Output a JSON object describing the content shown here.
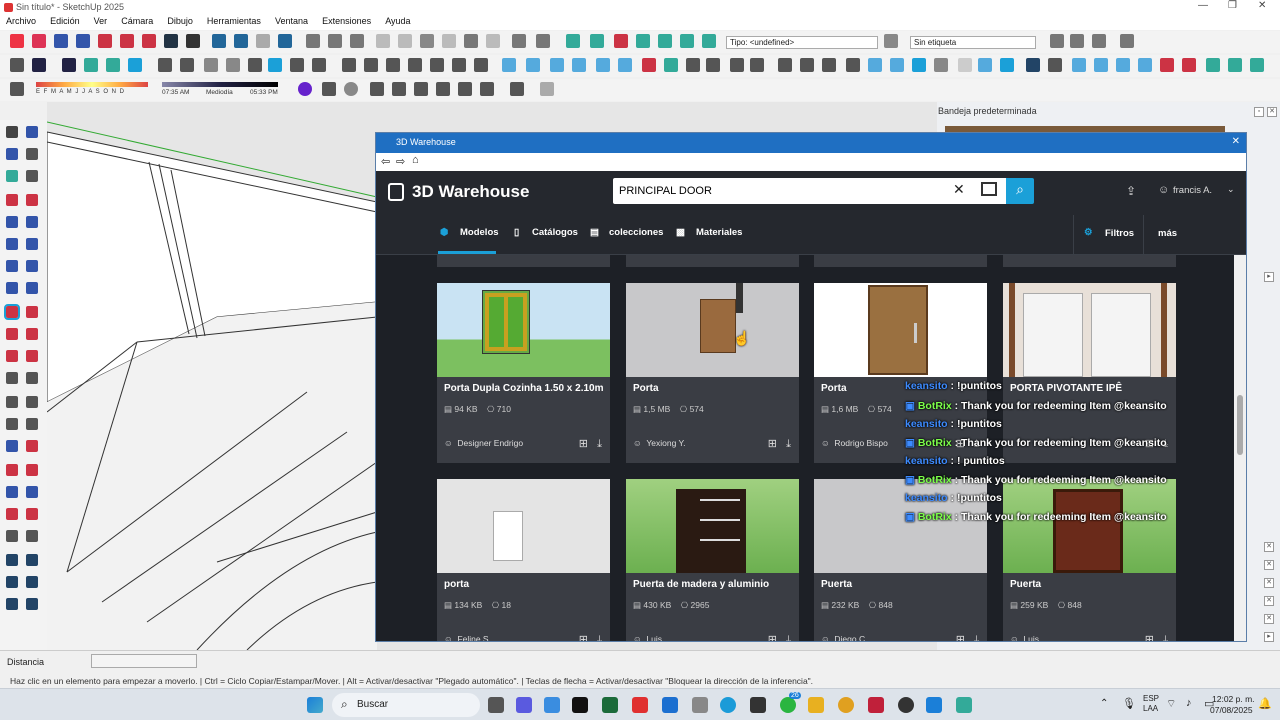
{
  "window": {
    "title": "Sin título* - SketchUp 2025"
  },
  "menu": [
    "Archivo",
    "Edición",
    "Ver",
    "Cámara",
    "Dibujo",
    "Herramientas",
    "Ventana",
    "Extensiones",
    "Ayuda"
  ],
  "toolbar": {
    "tag_dropdown": "Tipo: <undefined>",
    "label_dropdown": "Sin etiqueta",
    "shadow_months": "E F M A M J J A S O N D",
    "time_start": "07:35 AM",
    "time_mid": "Mediodía",
    "time_end": "05:33 PM"
  },
  "tray": {
    "title": "Bandeja predeterminada"
  },
  "status": {
    "measure_label": "Distancia",
    "hint": "Haz clic en un elemento para empezar a moverlo. | Ctrl = Ciclo Copiar/Estampar/Mover. | Alt = Activar/desactivar \"Plegado automático\". | Teclas de flecha = Activar/desactivar \"Bloquear la dirección de la inferencia\"."
  },
  "warehouse": {
    "title": "3D Warehouse",
    "logo": "3D Warehouse",
    "search_value": "PRINCIPAL DOOR",
    "user": "francis A.",
    "tabs": [
      "Modelos",
      "Catálogos",
      "colecciones",
      "Materiales"
    ],
    "filters": "Filtros",
    "more": "más",
    "cards": [
      {
        "name": "Porta Dupla Cozinha 1.50 x 2.10m",
        "size": "94 KB",
        "count": "710",
        "author": "Designer Endrigo"
      },
      {
        "name": "Porta",
        "size": "1,5 MB",
        "count": "574",
        "author": "Yexiong Y."
      },
      {
        "name": "Porta",
        "size": "1,6 MB",
        "count": "574",
        "author": "Rodrigo Bispo"
      },
      {
        "name": "PORTA PIVOTANTE IPÊ",
        "size": "",
        "count": "",
        "author": ""
      },
      {
        "name": "porta",
        "size": "134 KB",
        "count": "18",
        "author": "Feline S."
      },
      {
        "name": "Puerta de madera y aluminio",
        "size": "430 KB",
        "count": "2965",
        "author": "Luis"
      },
      {
        "name": "Puerta",
        "size": "232 KB",
        "count": "848",
        "author": "Diego C."
      },
      {
        "name": "Puerta",
        "size": "259 KB",
        "count": "848",
        "author": "Luis"
      }
    ]
  },
  "chat": [
    {
      "user": "keansito",
      "msg": ": !puntitos"
    },
    {
      "user": "BotRix",
      "msg": ": Thank you for redeeming Item @keansito"
    },
    {
      "user": "keansito",
      "msg": ": !puntitos"
    },
    {
      "user": "BotRix",
      "msg": ": Thank you for redeeming Item @keansito"
    },
    {
      "user": "keansito",
      "msg": ": ! puntitos"
    },
    {
      "user": "BotRix",
      "msg": ": Thank you for redeeming Item @keansito"
    },
    {
      "user": "keansito",
      "msg": ": !puntitos"
    },
    {
      "user": "BotRix",
      "msg": ": Thank you for redeeming Item @keansito"
    }
  ],
  "taskbar": {
    "search": "Buscar",
    "lang": "ESP",
    "lang2": "LAA",
    "time": "12:02 p. m.",
    "date": "07/08/2025",
    "badge": "26"
  },
  "colors": {
    "accent": "#1ba0d8",
    "dialog_title": "#1f6fc2",
    "botrix": "#7cff4a",
    "keansito": "#3d8bff"
  }
}
